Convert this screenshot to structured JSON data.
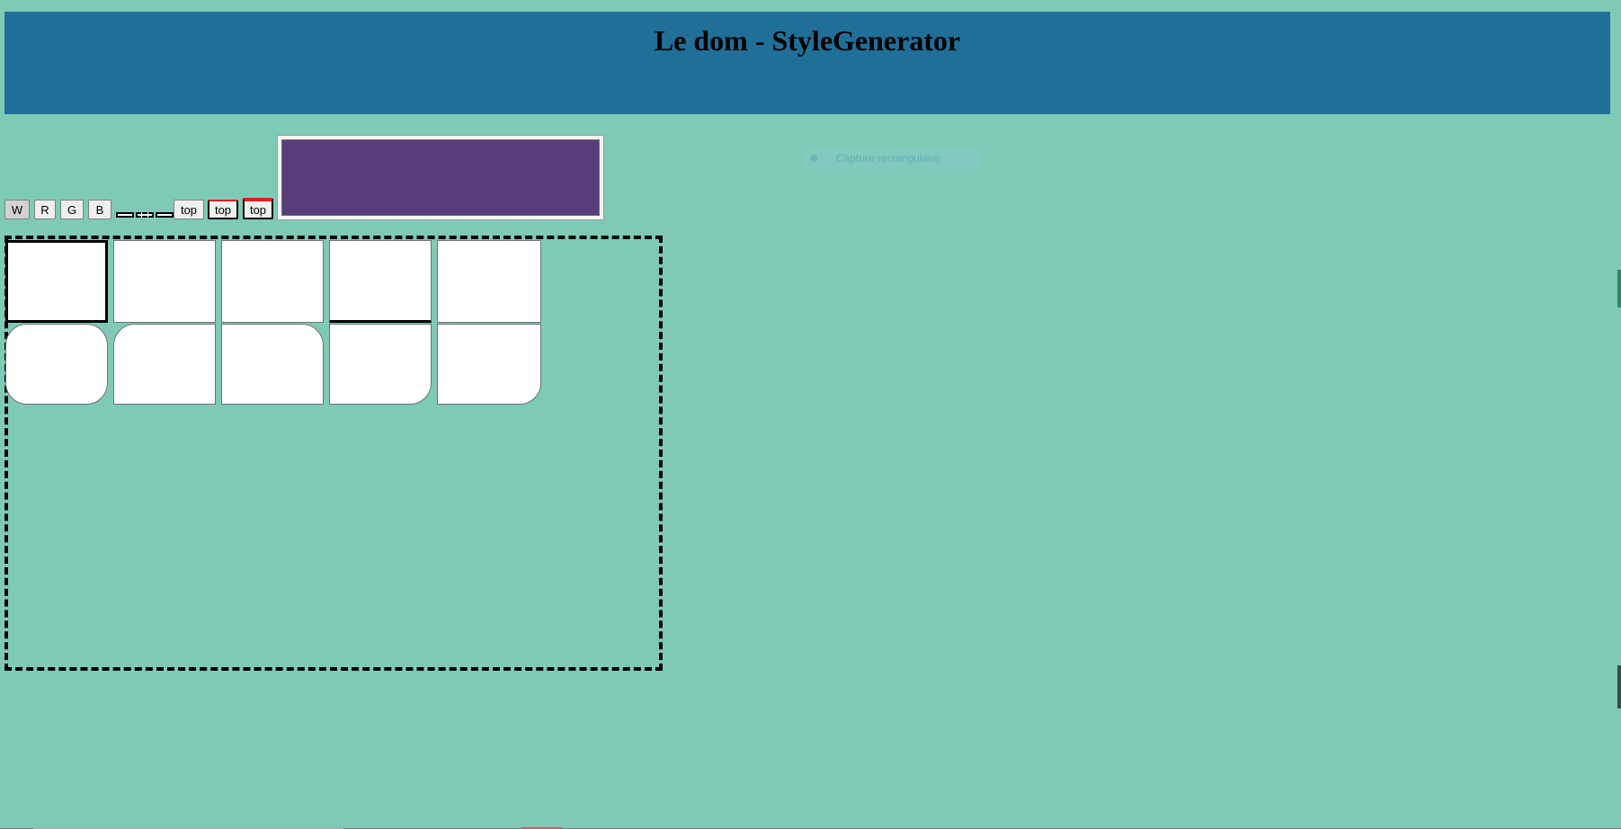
{
  "header": {
    "title": "Le dom - StyleGenerator",
    "background_color": "#206f99"
  },
  "page": {
    "background_color": "#7fcab6"
  },
  "preview": {
    "swatch_color": "#583e7a"
  },
  "capture_hint": {
    "label": "Capture rectangulaire"
  },
  "toolbar": {
    "color_buttons": [
      {
        "label": "W",
        "active": true
      },
      {
        "label": "R",
        "active": false
      },
      {
        "label": "G",
        "active": false
      },
      {
        "label": "B",
        "active": false
      }
    ],
    "border_styles": [
      "solid",
      "dashed",
      "solid"
    ],
    "top_buttons": [
      {
        "label": "top",
        "top_border_color": ""
      },
      {
        "label": "top",
        "top_border_color": "#e02020"
      },
      {
        "label": "top",
        "top_border_color": "#e02020"
      }
    ]
  },
  "boxes": {
    "row1_border_styles": [
      "thick-black",
      "thin",
      "thin",
      "thick-bottom",
      "thin"
    ],
    "row2_rounded_corners": [
      "all",
      "top-left",
      "top-right",
      "bottom-right",
      "bottom-right"
    ]
  }
}
